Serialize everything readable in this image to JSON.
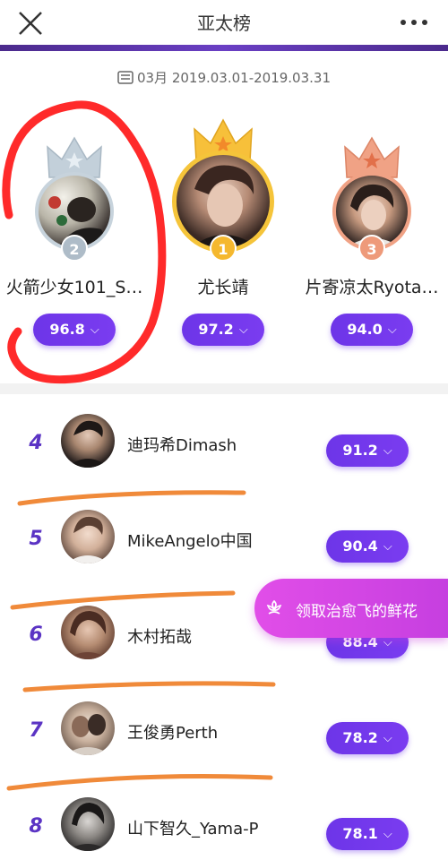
{
  "header": {
    "title": "亚太榜",
    "close_icon": "close-icon",
    "more_icon": "more-dots-icon"
  },
  "period": {
    "icon": "calendar-icon",
    "text": "03月 2019.03.01-2019.03.31"
  },
  "podium": [
    {
      "rank": "2",
      "name": "火箭少女101_S…",
      "score": "96.8",
      "crown": "silver"
    },
    {
      "rank": "1",
      "name": "尤长靖",
      "score": "97.2",
      "crown": "gold"
    },
    {
      "rank": "3",
      "name": "片寄凉太Ryota…",
      "score": "94.0",
      "crown": "bronze"
    }
  ],
  "list": [
    {
      "rank": "4",
      "name": "迪玛希Dimash",
      "score": "91.2"
    },
    {
      "rank": "5",
      "name": "MikeAngelo中国",
      "score": "90.4"
    },
    {
      "rank": "6",
      "name": "木村拓哉",
      "score": "88.4"
    },
    {
      "rank": "7",
      "name": "王俊勇Perth",
      "score": "78.2"
    },
    {
      "rank": "8",
      "name": "山下智久_Yama-P",
      "score": "78.1"
    }
  ],
  "floating_button": {
    "icon": "flower-icon",
    "label": "领取治愈飞的鲜花"
  },
  "colors": {
    "accent_purple": "#6d35e8",
    "rank_purple": "#5b34c4",
    "float_pink": "#d646e4",
    "gold": "#f5b82e",
    "silver": "#b8c6d0",
    "bronze": "#ee9a7a",
    "annotation_red": "#ff2a2a",
    "annotation_orange": "#f08a3a"
  }
}
